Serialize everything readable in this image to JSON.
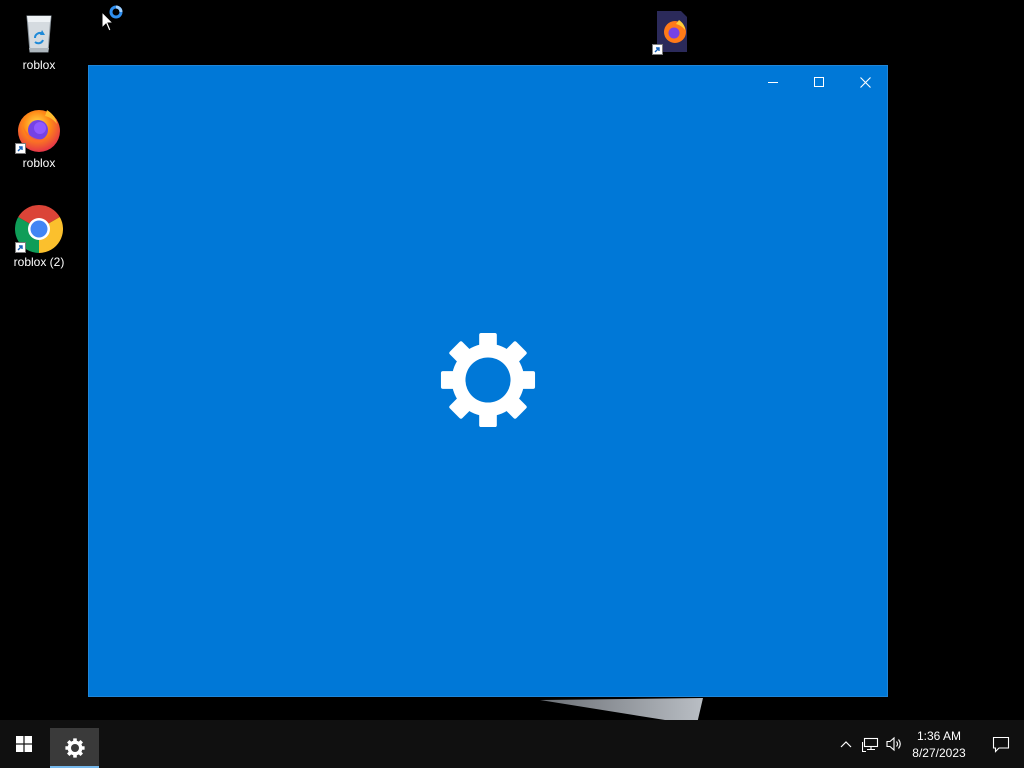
{
  "desktop": {
    "icons": [
      {
        "label": "roblox",
        "icon": "recycle-bin-icon"
      },
      {
        "label": "roblox",
        "icon": "firefox-icon"
      },
      {
        "label": "roblox (2)",
        "icon": "chrome-icon"
      },
      {
        "label": "",
        "icon": "firefox-file-icon"
      }
    ]
  },
  "window": {
    "app": "Settings",
    "state": "loading",
    "background": "#0078d7",
    "splash_icon": "gear-icon",
    "controls": [
      "minimize-icon",
      "maximize-icon",
      "close-icon"
    ]
  },
  "taskbar": {
    "start_icon": "windows-logo-icon",
    "pinned": [
      {
        "icon": "gear-icon",
        "active": true
      }
    ],
    "tray_icons": [
      "chevron-up-icon",
      "network-icon",
      "volume-icon"
    ],
    "clock": {
      "time": "1:36 AM",
      "date": "8/27/2023"
    },
    "notification_icon": "action-center-icon",
    "accent": "#76b9ed"
  }
}
